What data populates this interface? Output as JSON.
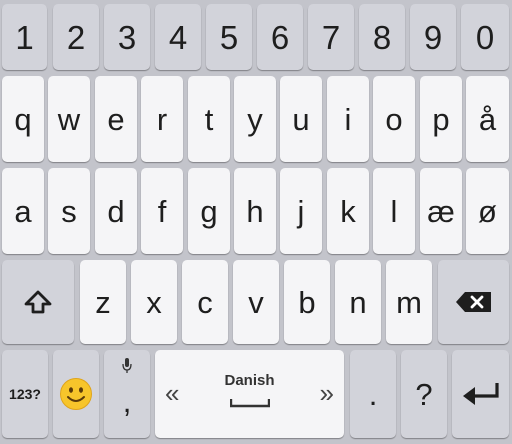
{
  "keyboard": {
    "language": "Danish",
    "colors": {
      "background": "#c3c4cb",
      "key": "#f5f5f7",
      "function_key": "#d2d3da",
      "text": "#1e1e1e"
    },
    "number_row": [
      "1",
      "2",
      "3",
      "4",
      "5",
      "6",
      "7",
      "8",
      "9",
      "0"
    ],
    "row2": [
      "q",
      "w",
      "e",
      "r",
      "t",
      "y",
      "u",
      "i",
      "o",
      "p",
      "å"
    ],
    "row3": [
      "a",
      "s",
      "d",
      "f",
      "g",
      "h",
      "j",
      "k",
      "l",
      "æ",
      "ø"
    ],
    "row4": [
      "z",
      "x",
      "c",
      "v",
      "b",
      "n",
      "m"
    ],
    "bottom_row": {
      "symbols_label": "123?",
      "comma_label": ",",
      "space_left_arrow": "«",
      "space_right_arrow": "»",
      "period_label": ".",
      "question_label": "?"
    },
    "icons": {
      "shift": "shift-icon",
      "backspace": "backspace-icon",
      "emoji": "emoji-icon",
      "mic": "microphone-icon",
      "enter": "enter-icon"
    }
  }
}
